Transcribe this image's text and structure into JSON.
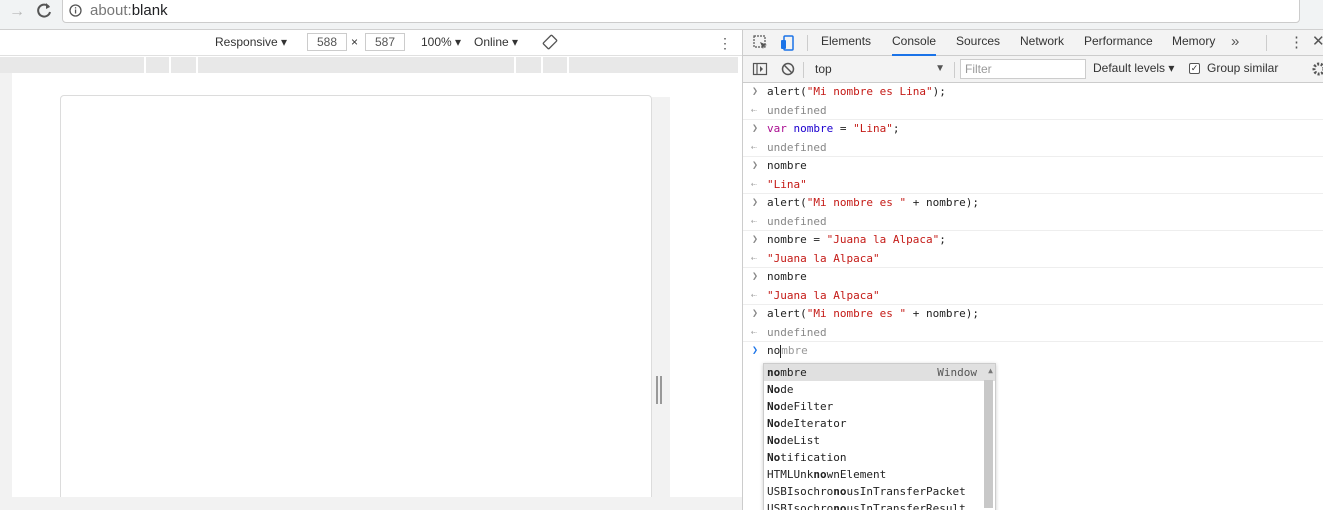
{
  "browser": {
    "url_scheme": "about:",
    "url_path": "blank"
  },
  "device_toolbar": {
    "mode": "Responsive",
    "width": "588",
    "times": "×",
    "height": "587",
    "zoom": "100%",
    "network": "Online"
  },
  "devtools": {
    "tabs": [
      "Elements",
      "Console",
      "Sources",
      "Network",
      "Performance",
      "Memory"
    ],
    "active_tab": "Console",
    "more_tabs": "»"
  },
  "console_toolbar": {
    "context": "top",
    "filter_placeholder": "Filter",
    "levels": "Default levels",
    "group_similar_label": "Group similar",
    "group_similar_checked": true
  },
  "console": {
    "entries": [
      {
        "type": "input",
        "parts": [
          [
            "plain",
            "alert("
          ],
          [
            "str",
            "\"Mi nombre es Lina\""
          ],
          [
            "plain",
            ");"
          ]
        ]
      },
      {
        "type": "result",
        "text": "undefined",
        "style": "undef"
      },
      {
        "type": "input",
        "parts": [
          [
            "kw",
            "var "
          ],
          [
            "vn",
            "nombre"
          ],
          [
            "plain",
            " = "
          ],
          [
            "str",
            "\"Lina\""
          ],
          [
            "plain",
            ";"
          ]
        ]
      },
      {
        "type": "result",
        "text": "undefined",
        "style": "undef"
      },
      {
        "type": "input",
        "parts": [
          [
            "plain",
            "nombre"
          ]
        ]
      },
      {
        "type": "result",
        "text": "\"Lina\"",
        "style": "str"
      },
      {
        "type": "input",
        "parts": [
          [
            "plain",
            "alert("
          ],
          [
            "str",
            "\"Mi nombre es \""
          ],
          [
            "plain",
            " + nombre);"
          ]
        ]
      },
      {
        "type": "result",
        "text": "undefined",
        "style": "undef"
      },
      {
        "type": "input",
        "parts": [
          [
            "plain",
            "nombre = "
          ],
          [
            "str",
            "\"Juana la Alpaca\""
          ],
          [
            "plain",
            ";"
          ]
        ]
      },
      {
        "type": "result",
        "text": "\"Juana la Alpaca\"",
        "style": "str"
      },
      {
        "type": "input",
        "parts": [
          [
            "plain",
            "nombre"
          ]
        ]
      },
      {
        "type": "result",
        "text": "\"Juana la Alpaca\"",
        "style": "str"
      },
      {
        "type": "input",
        "parts": [
          [
            "plain",
            "alert("
          ],
          [
            "str",
            "\"Mi nombre es \""
          ],
          [
            "plain",
            " + nombre);"
          ]
        ]
      },
      {
        "type": "result",
        "text": "undefined",
        "style": "undef"
      }
    ],
    "prompt_typed": "no",
    "prompt_ghost": "mbre",
    "suggestions": [
      {
        "match": "no",
        "rest": "mbre",
        "prefix": "",
        "sub": "Window"
      },
      {
        "match": "No",
        "rest": "de",
        "prefix": ""
      },
      {
        "match": "No",
        "rest": "deFilter",
        "prefix": ""
      },
      {
        "match": "No",
        "rest": "deIterator",
        "prefix": ""
      },
      {
        "match": "No",
        "rest": "deList",
        "prefix": ""
      },
      {
        "match": "No",
        "rest": "tification",
        "prefix": ""
      },
      {
        "match": "no",
        "rest": "wnElement",
        "prefix": "HTMLUnk"
      },
      {
        "match": "no",
        "rest": "usInTransferPacket",
        "prefix": "USBIsochro"
      },
      {
        "match": "no",
        "rest": "usInTransferResult",
        "prefix": "USBIsochro"
      }
    ]
  },
  "colors": {
    "accent": "#1a73e8",
    "string": "#c41a16",
    "keyword": "#aa0d91",
    "variable": "#1c00cf"
  }
}
